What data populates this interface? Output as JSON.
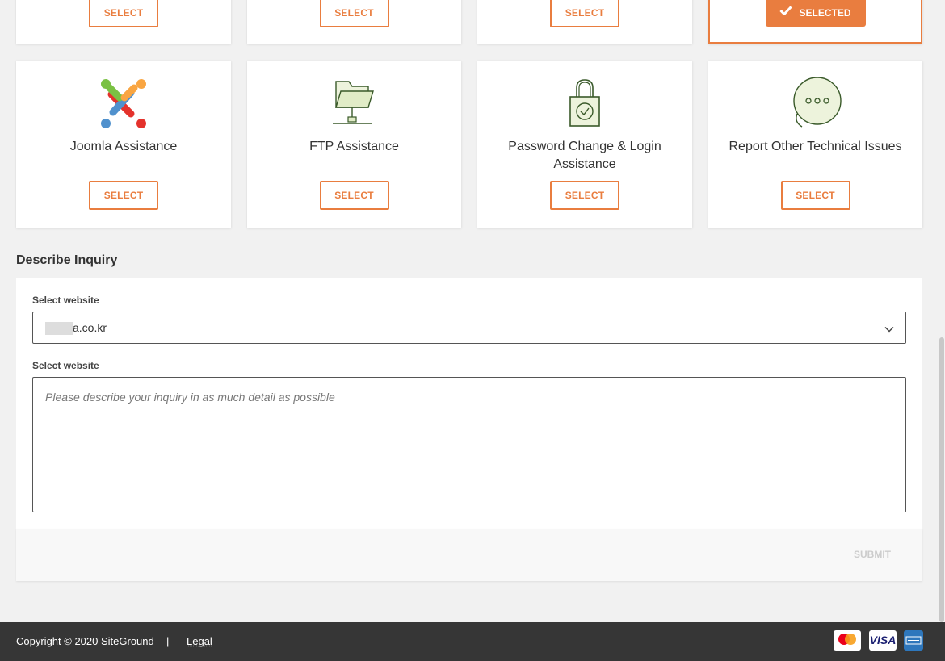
{
  "top_row": {
    "cards": [
      {
        "button_label": "SELECT"
      },
      {
        "button_label": "SELECT"
      },
      {
        "button_label": "SELECT"
      },
      {
        "button_label": "SELECTED",
        "selected": true
      }
    ]
  },
  "cards": [
    {
      "title": "Joomla Assistance",
      "button_label": "SELECT",
      "icon": "joomla-logo-icon"
    },
    {
      "title": "FTP Assistance",
      "button_label": "SELECT",
      "icon": "ftp-folder-icon"
    },
    {
      "title": "Password Change & Login Assistance",
      "button_label": "SELECT",
      "icon": "padlock-icon"
    },
    {
      "title": "Report Other Technical Issues",
      "button_label": "SELECT",
      "icon": "chat-bubble-icon"
    }
  ],
  "form": {
    "section_title": "Describe Inquiry",
    "website_label": "Select website",
    "website_value": "a.co.kr",
    "description_label": "Select website",
    "description_placeholder": "Please describe your inquiry in as much detail as possible",
    "submit_label": "SUBMIT"
  },
  "footer": {
    "copyright": "Copyright © 2020 SiteGround",
    "separator": "|",
    "legal": "Legal",
    "payment_icons": [
      "mastercard-icon",
      "visa-icon",
      "amex-icon"
    ],
    "visa_text": "VISA"
  },
  "colors": {
    "accent": "#e97d3f",
    "footer_bg": "#363636",
    "page_bg": "#f1f1f1"
  }
}
